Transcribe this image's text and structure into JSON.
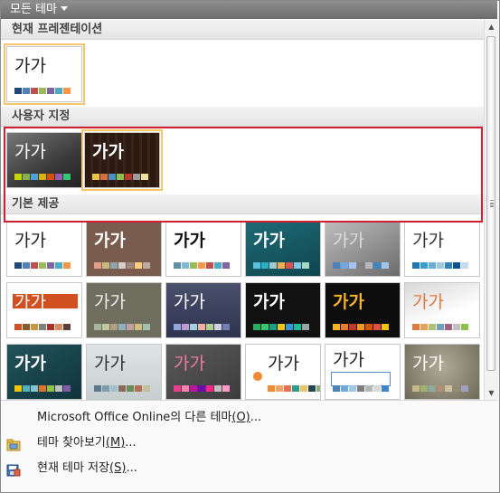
{
  "header": {
    "title": "모든 테마"
  },
  "sections": {
    "current": "현재 프레젠테이션",
    "custom": "사용자 지정",
    "builtin": "기본 제공"
  },
  "thumb_text": "가가",
  "menu": {
    "online": {
      "label": "Microsoft Office Online의 다른 테마",
      "key": "(O)",
      "suffix": "..."
    },
    "browse": {
      "label": "테마 찾아보기",
      "key": "(M)",
      "suffix": "..."
    },
    "save": {
      "label": "현재 테마 저장",
      "key": "(S)",
      "suffix": "..."
    }
  },
  "colors": {
    "selection_outline": "#f7c56b",
    "highlight_box": "#d0202f",
    "topbar": "#7a7a7a"
  },
  "icons": {
    "browse": "folder-icon",
    "save": "save-theme-icon",
    "dropdown": "chevron-down-icon"
  }
}
